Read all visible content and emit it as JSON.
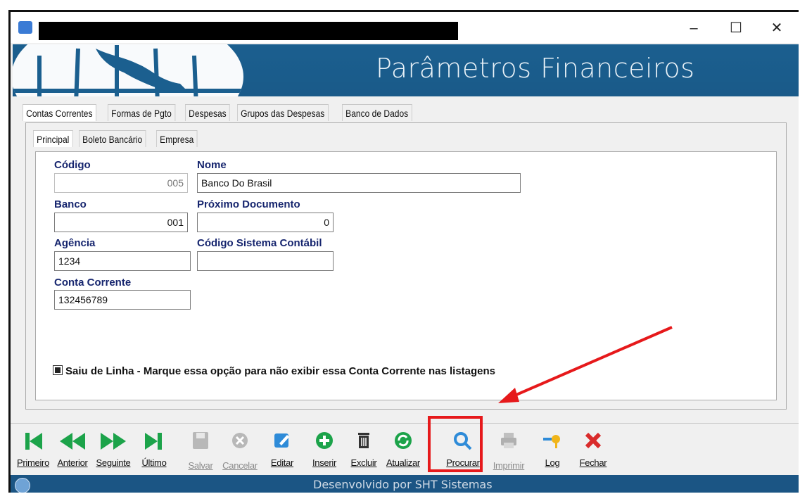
{
  "window": {
    "minimize": "–",
    "maximize": "☐",
    "close": "✕"
  },
  "banner": {
    "title": "Parâmetros Financeiros"
  },
  "tabs_main": [
    "Contas Correntes",
    "Formas de Pgto",
    "Despesas",
    "Grupos das Despesas",
    "Banco de Dados"
  ],
  "tabs_sub": [
    "Principal",
    "Boleto Bancário",
    "Empresa"
  ],
  "form": {
    "codigo": {
      "label": "Código",
      "value": "005"
    },
    "nome": {
      "label": "Nome",
      "value": "Banco Do Brasil"
    },
    "banco": {
      "label": "Banco",
      "value": "001"
    },
    "proximo_documento": {
      "label": "Próximo Documento",
      "value": "0"
    },
    "agencia": {
      "label": "Agência",
      "value": "1234"
    },
    "codigo_sistema_contabil": {
      "label": "Código Sistema Contábil",
      "value": ""
    },
    "conta_corrente": {
      "label": "Conta Corrente",
      "value": "132456789"
    },
    "saiu_de_linha": {
      "label": "Saiu de Linha - Marque essa opção para não exibir essa Conta Corrente nas listagens",
      "checked": true
    }
  },
  "toolbar": {
    "primeiro": "Primeiro",
    "anterior": "Anterior",
    "seguinte": "Seguinte",
    "ultimo": "Último",
    "salvar": "Salvar",
    "cancelar": "Cancelar",
    "editar": "Editar",
    "inserir": "Inserir",
    "excluir": "Excluir",
    "atualizar": "Atualizar",
    "procurar": "Procurar",
    "imprimir": "Imprimir",
    "log": "Log",
    "fechar": "Fechar"
  },
  "footer": {
    "text": "Desenvolvido por SHT Sistemas"
  },
  "colors": {
    "banner": "#1b5f8f",
    "label": "#16256e",
    "nav_green": "#1ca34a",
    "highlight": "#e6191b"
  }
}
